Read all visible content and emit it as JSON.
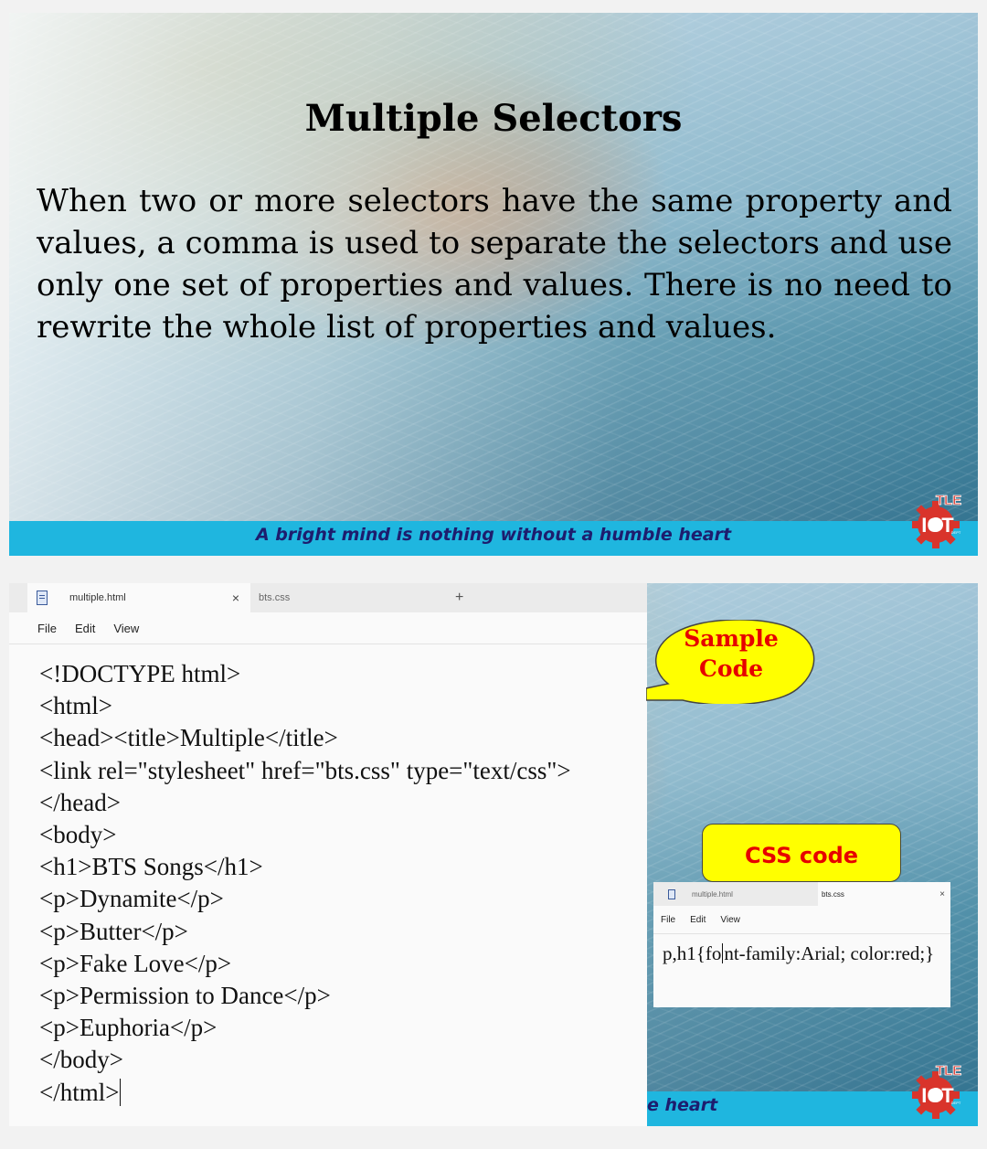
{
  "slide1": {
    "title": "Multiple Selectors",
    "body": "When two or more selectors have the same property and values, a comma is used to separate the selectors and use only one set of properties and values.  There is no need to rewrite the whole list of properties and values.",
    "footer": "A bright mind is nothing without a humble heart",
    "logo": {
      "line1": "TLE",
      "line2": "ICT",
      "sub": "DEPT"
    }
  },
  "slide2": {
    "notepad": {
      "active_tab": "multiple.html",
      "inactive_tab": "bts.css",
      "close_glyph": "×",
      "new_tab_glyph": "+",
      "menu": [
        "File",
        "Edit",
        "View"
      ],
      "code_lines": [
        "<!DOCTYPE html>",
        "<html>",
        "<head><title>Multiple</title>",
        "<link rel=\"stylesheet\" href=\"bts.css\" type=\"text/css\">",
        "</head>",
        "<body>",
        "<h1>BTS Songs</h1>",
        "<p>Dynamite</p>",
        "<p>Butter</p>",
        "<p>Fake Love</p>",
        "<p>Permission to Dance</p>",
        "<p>Euphoria</p>",
        "</body>",
        "</html>"
      ]
    },
    "bubble_sample": {
      "line1": "Sample",
      "line2": "Code"
    },
    "bubble_css": "CSS code",
    "mini_notepad": {
      "inactive_tab": "multiple.html",
      "active_tab": "bts.css",
      "close_glyph": "×",
      "menu": [
        "File",
        "Edit",
        "View"
      ],
      "code_before_caret": "p,h1{fo",
      "code_after_caret": "nt-family:Arial; color:red;}"
    },
    "footer_partial": "e heart",
    "logo": {
      "line1": "TLE",
      "line2": "ICT",
      "sub": "DEPT"
    }
  },
  "colors": {
    "footer_bar": "#1fb6df",
    "footer_text": "#1d1d6e",
    "bubble_fill": "#ffff00",
    "bubble_text": "#e60000",
    "logo_red": "#d9342b"
  },
  "icons": [
    "file-icon",
    "close-icon",
    "plus-icon",
    "gear-icon"
  ]
}
